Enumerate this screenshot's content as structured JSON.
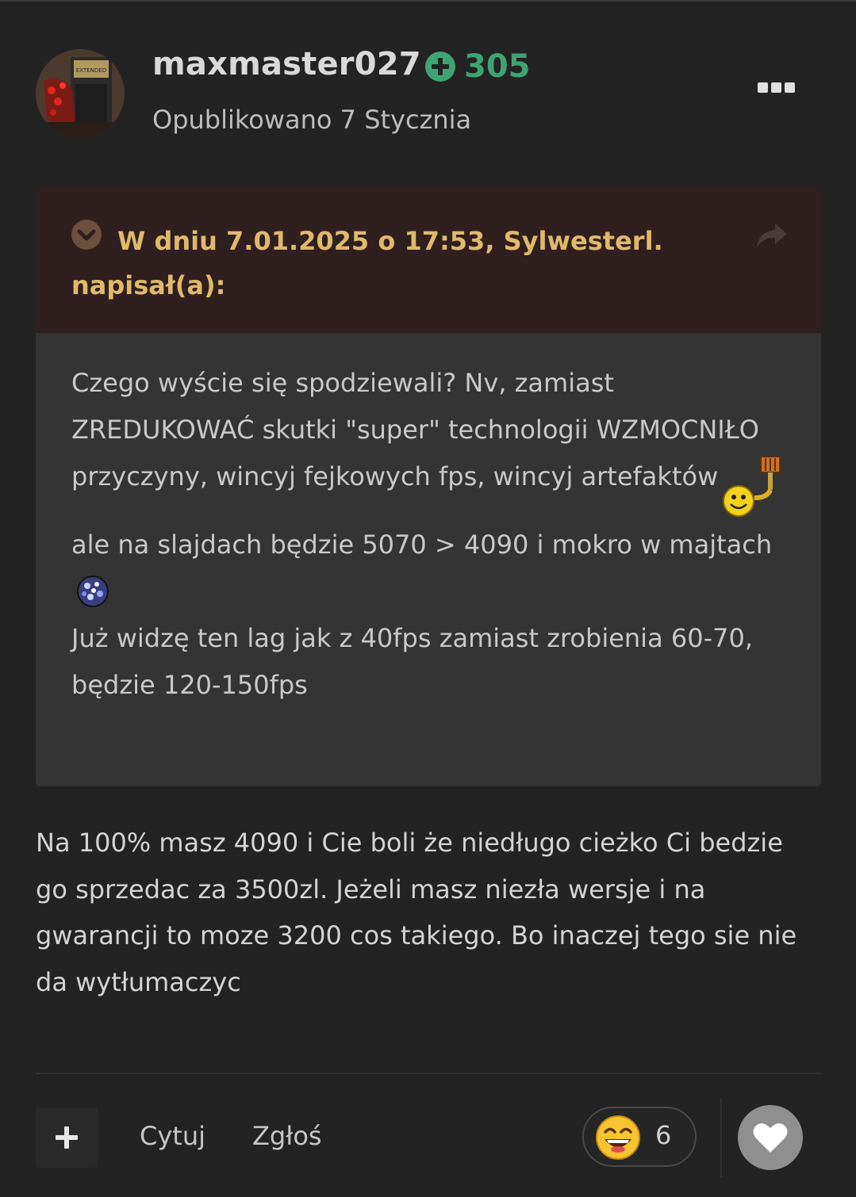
{
  "post": {
    "author": "maxmaster027",
    "reputation": "305",
    "posted": "Opublikowano 7 Stycznia",
    "avatar_text": "EXTENDED"
  },
  "quote": {
    "citation": "W dniu 7.01.2025 o 17:53, Sylwesterl. napisał(a):",
    "line1": "Czego wyście się spodziewali? Nv, zamiast ZREDUKOWAĆ skutki \"super\" technologii WZMOCNIŁO przyczyny, wincyj fejkowych fps, wincyj artefaktów",
    "line2": "ale na slajdach będzie 5070 > 4090 i mokro w majtach",
    "line3": "Już widzę ten lag jak z 40fps zamiast zrobienia 60-70, będzie 120-150fps"
  },
  "reply": {
    "text": "Na 100% masz 4090 i Cie boli że niedługo cieżko Ci bedzie go sprzedac za 3500zl. Jeżeli masz niezła wersje i na gwarancji to moze 3200 cos takiego. Bo inaczej tego sie nie da wytłumaczyc"
  },
  "actions": {
    "quote_label": "Cytuj",
    "report_label": "Zgłoś",
    "reaction_count": "6"
  },
  "colors": {
    "background": "#232323",
    "reputation": "#3fa474",
    "citation": "#e0b96a",
    "quote_header": "#2f1f1f",
    "quote_body": "#343434"
  },
  "icons": {
    "reputation": "plus-circle-icon",
    "menu": "more-horizontal-icon",
    "expand": "chevron-down-circle-icon",
    "share": "share-arrow-icon",
    "add": "plus-icon",
    "reaction": "laughing-face-icon",
    "like": "heart-icon"
  }
}
